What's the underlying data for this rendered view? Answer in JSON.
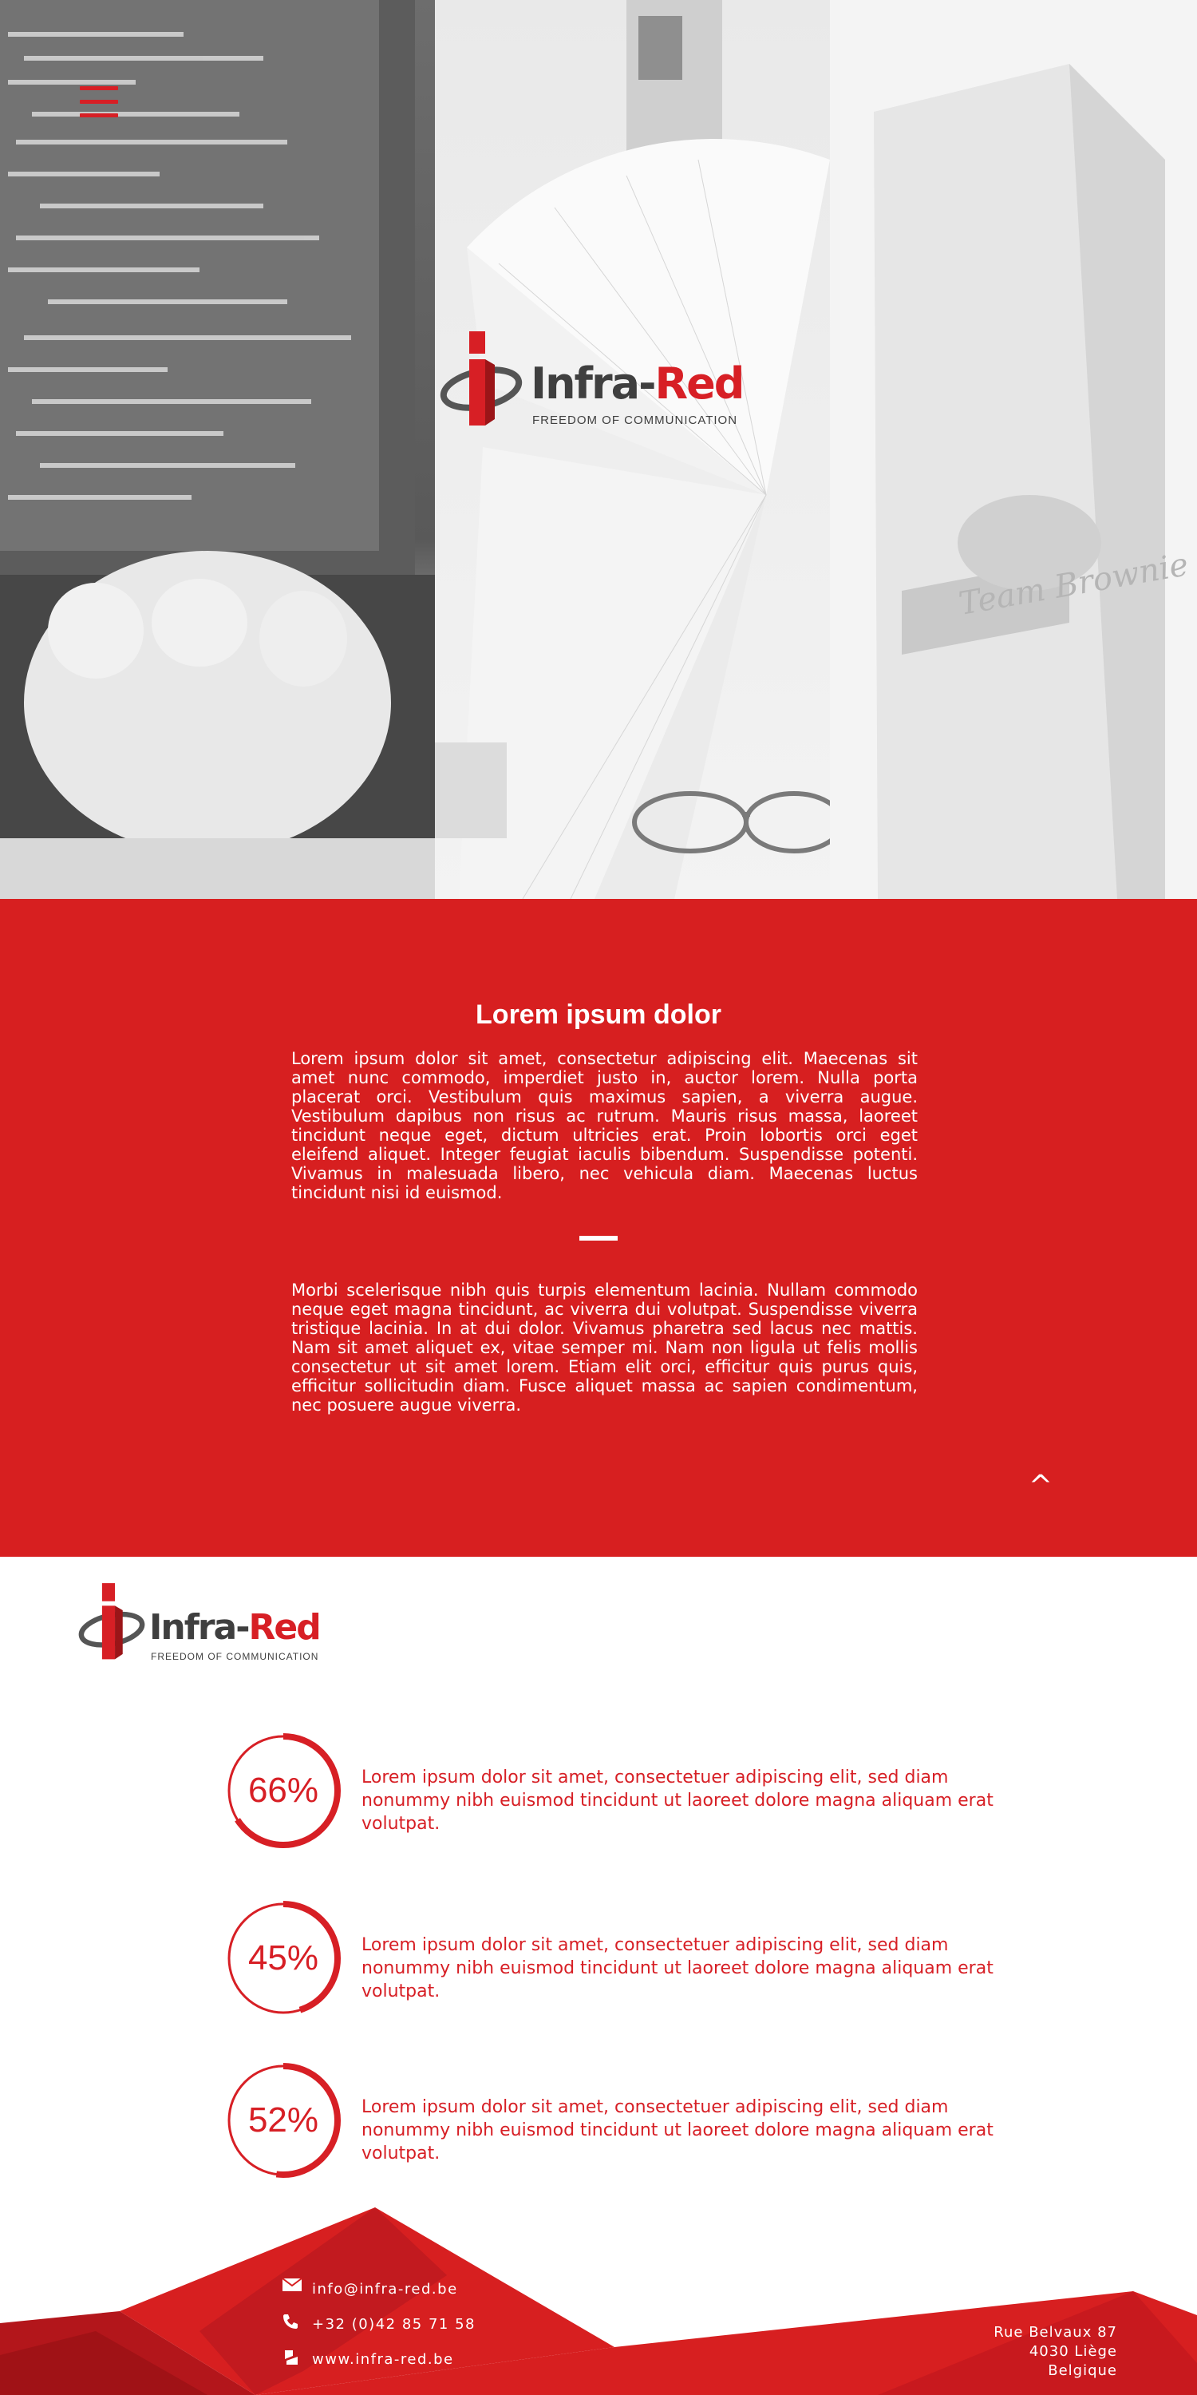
{
  "hero": {
    "menu_icon": "hamburger-menu-icon",
    "logo": {
      "word_dark": "Infra-",
      "word_red": "Red",
      "tagline": "FREEDOM OF COMMUNICATION"
    }
  },
  "intro": {
    "title": "Lorem ipsum dolor",
    "paragraph_1": "Lorem ipsum dolor sit amet, consectetur adipiscing elit. Maecenas sit amet nunc commodo, imperdiet justo in, auctor lorem. Nulla porta placerat orci. Vestibulum quis maximus sapien, a viverra augue. Vestibulum dapibus non risus ac rutrum. Mauris risus massa, laoreet tincidunt neque eget, dictum ultricies erat. Proin lobortis orci eget eleifend aliquet. Integer feugiat iaculis bibendum. Suspendisse potenti. Vivamus in malesuada libero, nec vehicula diam. Maecenas luctus tincidunt nisi id euismod.",
    "paragraph_2": "Morbi scelerisque nibh quis turpis elementum lacinia. Nullam commodo neque eget magna tincidunt, ac viverra dui volutpat. Suspendisse viverra tristique lacinia. In at dui dolor. Vivamus pharetra sed lacus nec mattis. Nam sit amet aliquet ex, vitae semper mi. Nam non ligula ut felis mollis consectetur ut sit amet lorem. Etiam elit orci, efficitur quis purus quis, efficitur sollicitudin diam. Fusce aliquet massa ac sapien condimentum, nec posuere augue viverra.",
    "scroll_up_glyph": "^"
  },
  "stats": [
    {
      "label": "66%",
      "percent": 66,
      "text": "Lorem ipsum dolor sit amet, consectetuer adipiscing elit, sed diam nonummy nibh euismod tincidunt ut laoreet dolore magna aliquam erat volutpat."
    },
    {
      "label": "45%",
      "percent": 45,
      "text": "Lorem ipsum dolor sit amet, consectetuer adipiscing elit, sed diam nonummy nibh euismod tincidunt ut laoreet dolore magna aliquam erat volutpat."
    },
    {
      "label": "52%",
      "percent": 52,
      "text": "Lorem ipsum dolor sit amet, consectetuer adipiscing elit, sed diam nonummy nibh euismod tincidunt ut laoreet dolore magna aliquam erat volutpat."
    }
  ],
  "footer": {
    "email": "info@infra-red.be",
    "phone": "+32 (0)42 85 71 58",
    "website": "www.infra-red.be",
    "address": [
      "Rue Belvaux 87",
      "4030 Liège",
      "Belgique"
    ],
    "icons": {
      "email": "envelope-icon",
      "phone": "phone-icon",
      "website": "web-icon"
    }
  },
  "colors": {
    "brand_red": "#d71f25",
    "dark_gray": "#3f3f3f",
    "section_red": "#d71f20"
  }
}
